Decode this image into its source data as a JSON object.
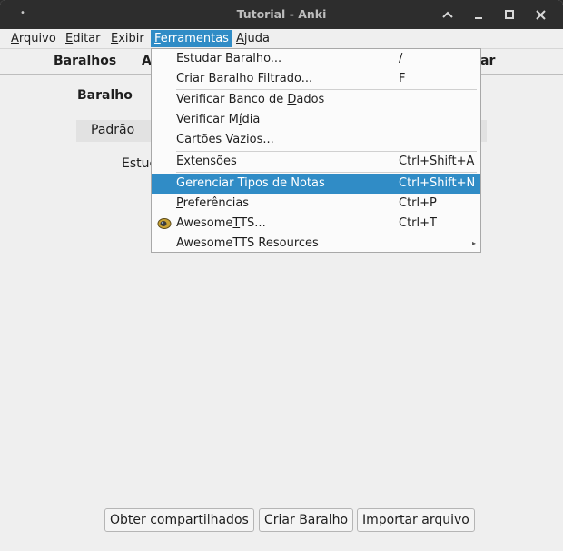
{
  "window": {
    "title": "Tutorial - Anki",
    "dot": "•"
  },
  "menubar": {
    "items": [
      {
        "first": "A",
        "rest": "rquivo"
      },
      {
        "first": "E",
        "rest": "ditar"
      },
      {
        "first": "E",
        "rest": "xibir"
      },
      {
        "first": "F",
        "rest": "erramentas"
      },
      {
        "first": "A",
        "rest": "juda"
      }
    ]
  },
  "toolbar": {
    "decks": "Baralhos",
    "add_partial": "A",
    "browse_partial": "ar"
  },
  "main": {
    "deck_header": "Baralho",
    "deck_name": "Padrão",
    "study_partial": "Estuc"
  },
  "bottom_buttons": {
    "get_shared": "Obter compartilhados",
    "create_deck": "Criar Baralho",
    "import_file": "Importar arquivo"
  },
  "dropdown": {
    "study_deck": {
      "label": "Estudar Baralho...",
      "shortcut": "/"
    },
    "create_filtered": {
      "label": "Criar Baralho Filtrado...",
      "shortcut": "F"
    },
    "check_db": {
      "pre": "Verificar Banco de ",
      "u": "D",
      "post": "ados"
    },
    "check_media": {
      "pre": "Verificar M",
      "u": "í",
      "post": "dia"
    },
    "empty_cards": {
      "label": "Cartões Vazios..."
    },
    "addons": {
      "label": "Extensões",
      "shortcut": "Ctrl+Shift+A"
    },
    "manage_note_types": {
      "label": "Gerenciar Tipos de Notas",
      "shortcut": "Ctrl+Shift+N"
    },
    "preferences": {
      "u": "P",
      "post": "referências",
      "shortcut": "Ctrl+P"
    },
    "awesometts": {
      "pre": "Awesome",
      "u": "T",
      "post": "TS...",
      "shortcut": "Ctrl+T"
    },
    "awesometts_resources": {
      "label": "AwesomeTTS Resources",
      "arrow": "▸"
    }
  },
  "colors": {
    "highlight": "#308cc6",
    "titlebar": "#2d2d2d",
    "background": "#efefef"
  }
}
